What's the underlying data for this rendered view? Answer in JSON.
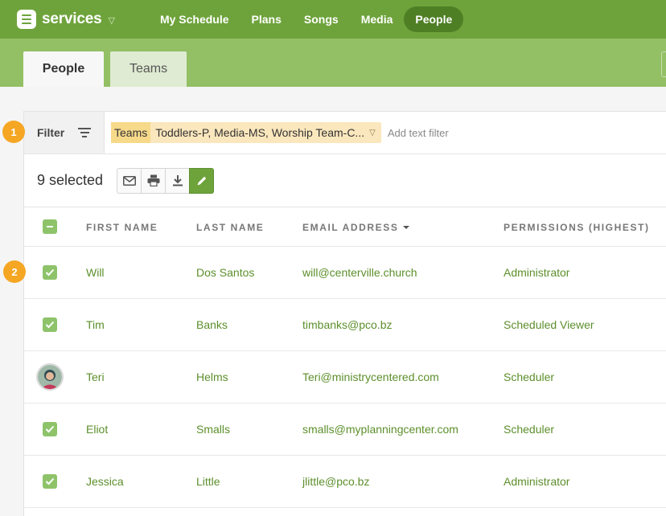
{
  "nav": {
    "app_name": "services",
    "links": [
      {
        "label": "My Schedule",
        "active": false
      },
      {
        "label": "Plans",
        "active": false
      },
      {
        "label": "Songs",
        "active": false
      },
      {
        "label": "Media",
        "active": false
      },
      {
        "label": "People",
        "active": true
      }
    ]
  },
  "tabs": [
    {
      "label": "People",
      "active": true
    },
    {
      "label": "Teams",
      "active": false
    }
  ],
  "filter": {
    "label": "Filter",
    "chip_key": "Teams",
    "chip_value": "Toddlers-P, Media-MS, Worship Team-C...",
    "add_placeholder": "Add text filter"
  },
  "selection": {
    "count_text": "9 selected",
    "actions": [
      "mail-icon",
      "print-icon",
      "download-icon",
      "pencil-icon"
    ]
  },
  "table": {
    "headers": {
      "first_name": "FIRST NAME",
      "last_name": "LAST NAME",
      "email": "EMAIL ADDRESS",
      "permissions": "PERMISSIONS (HIGHEST)"
    },
    "rows": [
      {
        "first": "Will",
        "last": "Dos Santos",
        "email": "will@centerville.church",
        "permission": "Administrator",
        "checked": true
      },
      {
        "first": "Tim",
        "last": "Banks",
        "email": "timbanks@pco.bz",
        "permission": "Scheduled Viewer",
        "checked": true
      },
      {
        "first": "Teri",
        "last": "Helms",
        "email": "Teri@ministrycentered.com",
        "permission": "Scheduler",
        "checked": false
      },
      {
        "first": "Eliot",
        "last": "Smalls",
        "email": "smalls@myplanningcenter.com",
        "permission": "Scheduler",
        "checked": true
      },
      {
        "first": "Jessica",
        "last": "Little",
        "email": "jlittle@pco.bz",
        "permission": "Administrator",
        "checked": true
      }
    ]
  },
  "callouts": [
    "1",
    "2"
  ],
  "colors": {
    "brand_green": "#6ea33b",
    "light_green": "#93c064",
    "link_green": "#5c8f2b",
    "callout_orange": "#f5a623",
    "chip_yellow": "#fbe7bd"
  }
}
